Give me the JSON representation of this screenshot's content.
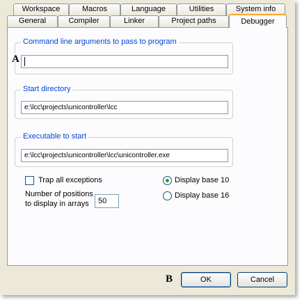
{
  "tabs": {
    "row1": [
      {
        "label": "Workspace"
      },
      {
        "label": "Macros"
      },
      {
        "label": "Language"
      },
      {
        "label": "Utilities"
      },
      {
        "label": "System info"
      }
    ],
    "row2": [
      {
        "label": "General"
      },
      {
        "label": "Compiler"
      },
      {
        "label": "Linker"
      },
      {
        "label": "Project paths"
      },
      {
        "label": "Debugger"
      }
    ],
    "active": "Debugger"
  },
  "groups": {
    "cmdline": {
      "label": "Command line arguments to pass to program",
      "value": ""
    },
    "startdir": {
      "label": "Start directory",
      "value": "e:\\lcc\\projects\\unicontroller\\lcc"
    },
    "exe": {
      "label": "Executable to start",
      "value": "e:\\lcc\\projects\\unicontroller\\lcc\\unicontroller.exe"
    }
  },
  "options": {
    "trap_label": "Trap all exceptions",
    "trap_checked": false,
    "positions_label_line1": "Number of positions",
    "positions_label_line2": "to display in arrays",
    "positions_value": "50",
    "base10_label": "Display base 10",
    "base16_label": "Display base 16",
    "selected_base": "10"
  },
  "markers": {
    "a": "A",
    "b": "B"
  },
  "buttons": {
    "ok": "OK",
    "cancel": "Cancel"
  },
  "colors": {
    "dialog_bg": "#ece9d8",
    "panel_bg": "#fcfcfe",
    "group_label": "#0046d5",
    "active_tab_accent": "#f8a630",
    "radio_dot": "#21a121",
    "border": "#919b9c"
  }
}
